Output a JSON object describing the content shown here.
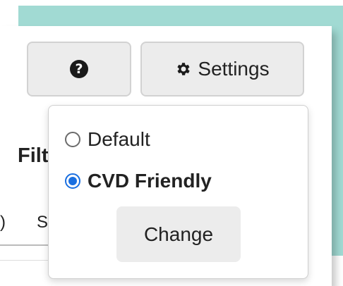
{
  "toolbar": {
    "help_icon": "question-circle-icon",
    "help_glyph": "?",
    "settings_label": "Settings",
    "settings_icon": "gear-icon"
  },
  "page": {
    "filter_title_fragment": "Filt",
    "tab_fragment_left": ")",
    "tab_fragment_right": "S"
  },
  "color_menu": {
    "options": [
      {
        "label": "Default",
        "selected": false
      },
      {
        "label": "CVD Friendly",
        "selected": true
      }
    ],
    "change_label": "Change",
    "accent_color": "#1a6fe0"
  },
  "colors": {
    "backdrop": "#a1dad3",
    "button_bg": "#ececec"
  }
}
